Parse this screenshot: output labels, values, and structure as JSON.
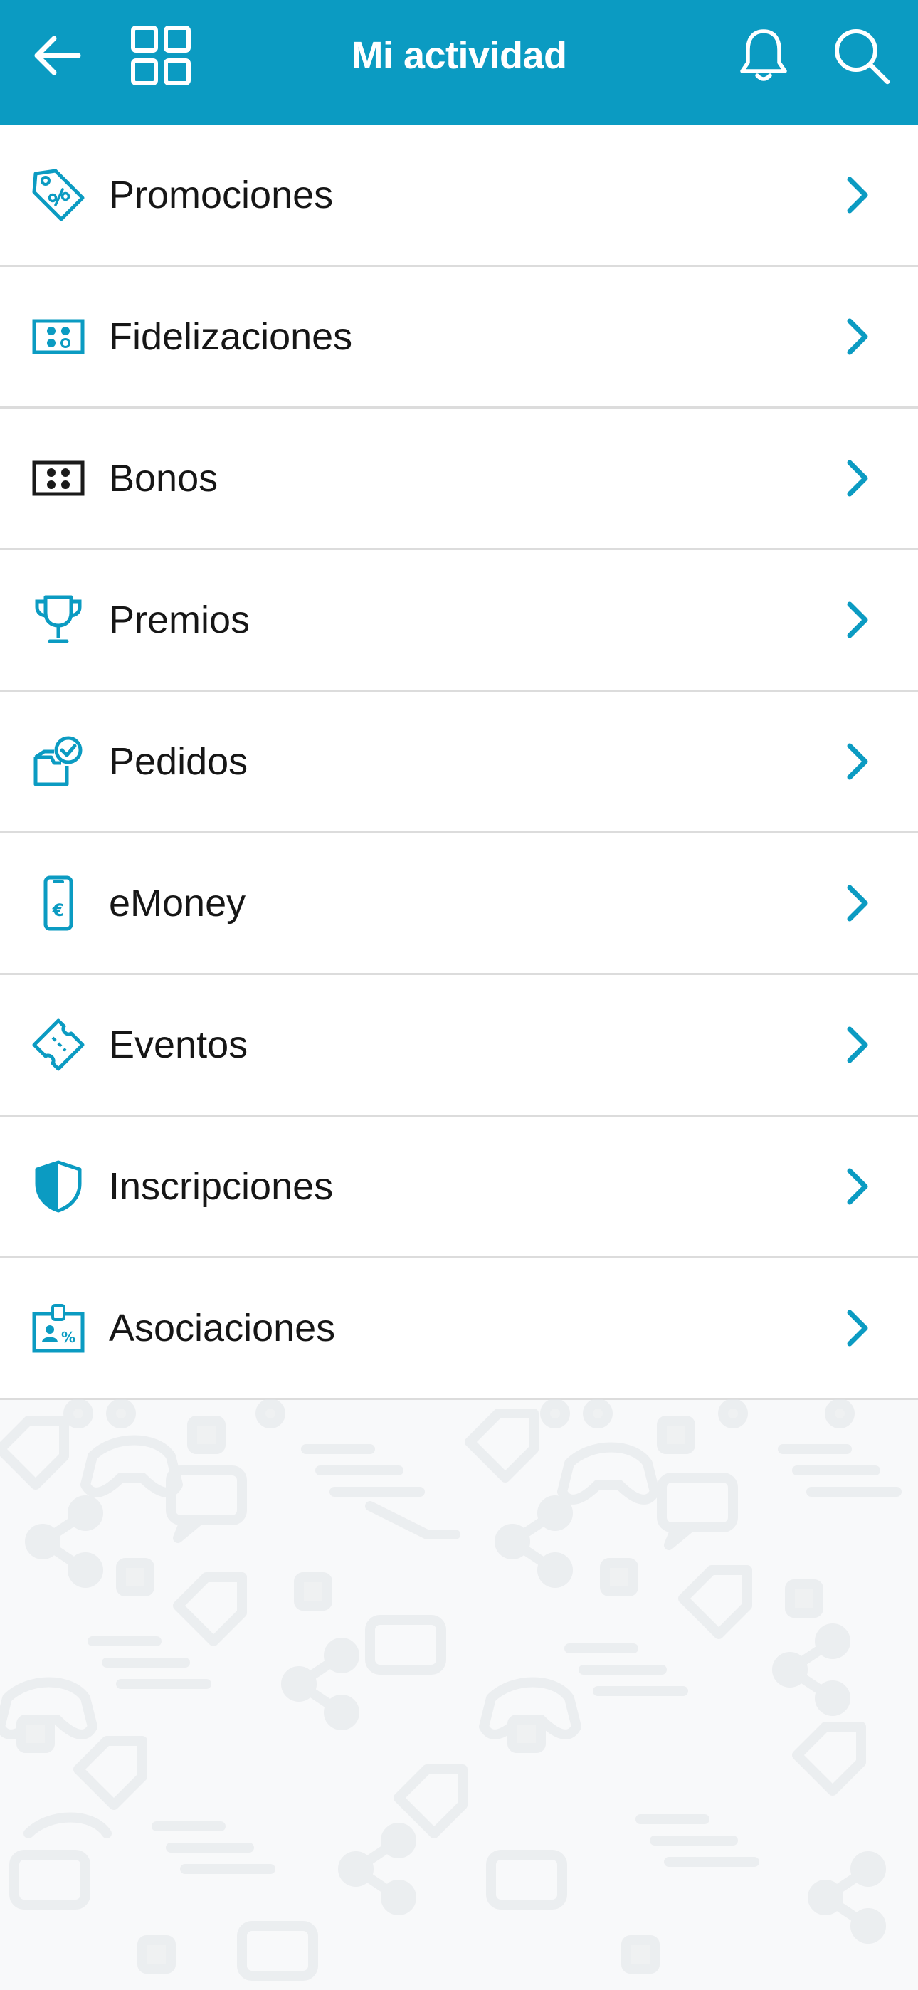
{
  "header": {
    "title": "Mi actividad",
    "back_icon": "arrow-left-icon",
    "grid_icon": "grid-icon",
    "notification_icon": "bell-icon",
    "search_icon": "search-icon"
  },
  "menu": {
    "items": [
      {
        "label": "Promociones",
        "icon": "price-tag-icon"
      },
      {
        "label": "Fidelizaciones",
        "icon": "loyalty-card-icon"
      },
      {
        "label": "Bonos",
        "icon": "voucher-icon"
      },
      {
        "label": "Premios",
        "icon": "trophy-icon"
      },
      {
        "label": "Pedidos",
        "icon": "order-check-icon"
      },
      {
        "label": "eMoney",
        "icon": "phone-euro-icon"
      },
      {
        "label": "Eventos",
        "icon": "ticket-icon"
      },
      {
        "label": "Inscripciones",
        "icon": "shield-icon"
      },
      {
        "label": "Asociaciones",
        "icon": "id-badge-icon"
      }
    ]
  },
  "colors": {
    "accent": "#0b9bc2",
    "header_bg": "#0b9bc2",
    "text": "#161616",
    "divider": "#dcdcdc",
    "background": "#f8f9fa"
  }
}
